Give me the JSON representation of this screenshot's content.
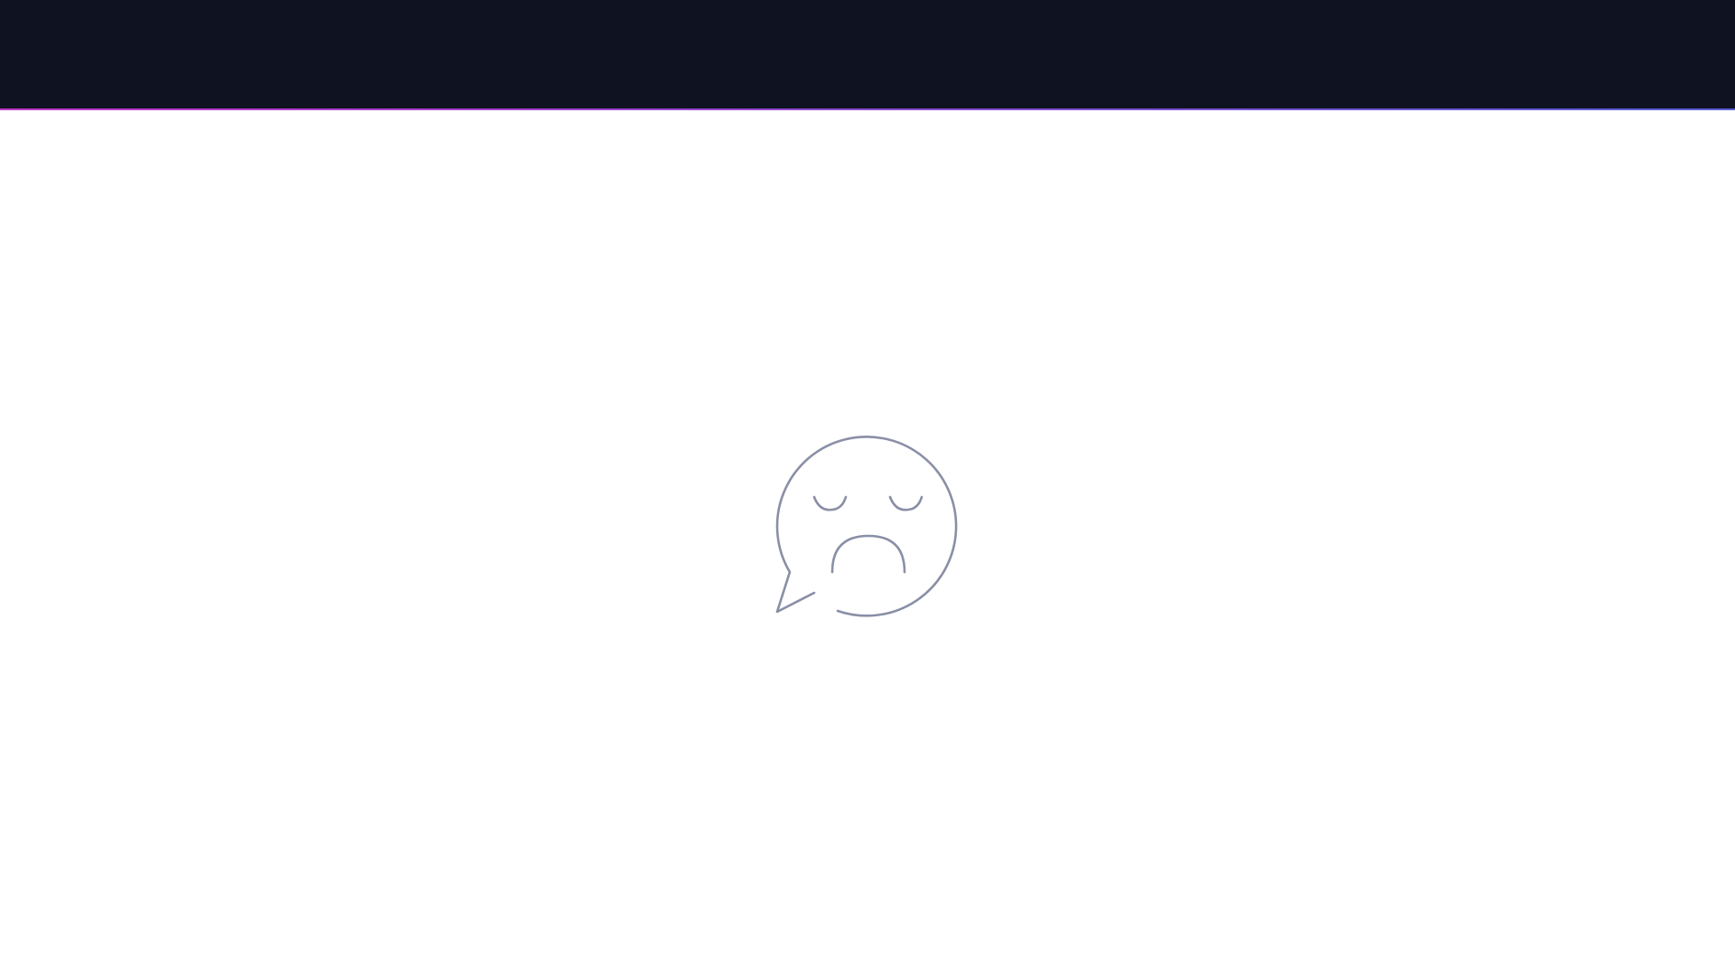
{
  "colors": {
    "top_bar": "#0f1220",
    "accent_start": "#c038c8",
    "accent_end": "#5a5fd8",
    "background": "#ffffff",
    "icon_stroke": "#8a8fa6"
  },
  "empty_state": {
    "icon": "sad-speech-bubble-icon"
  }
}
